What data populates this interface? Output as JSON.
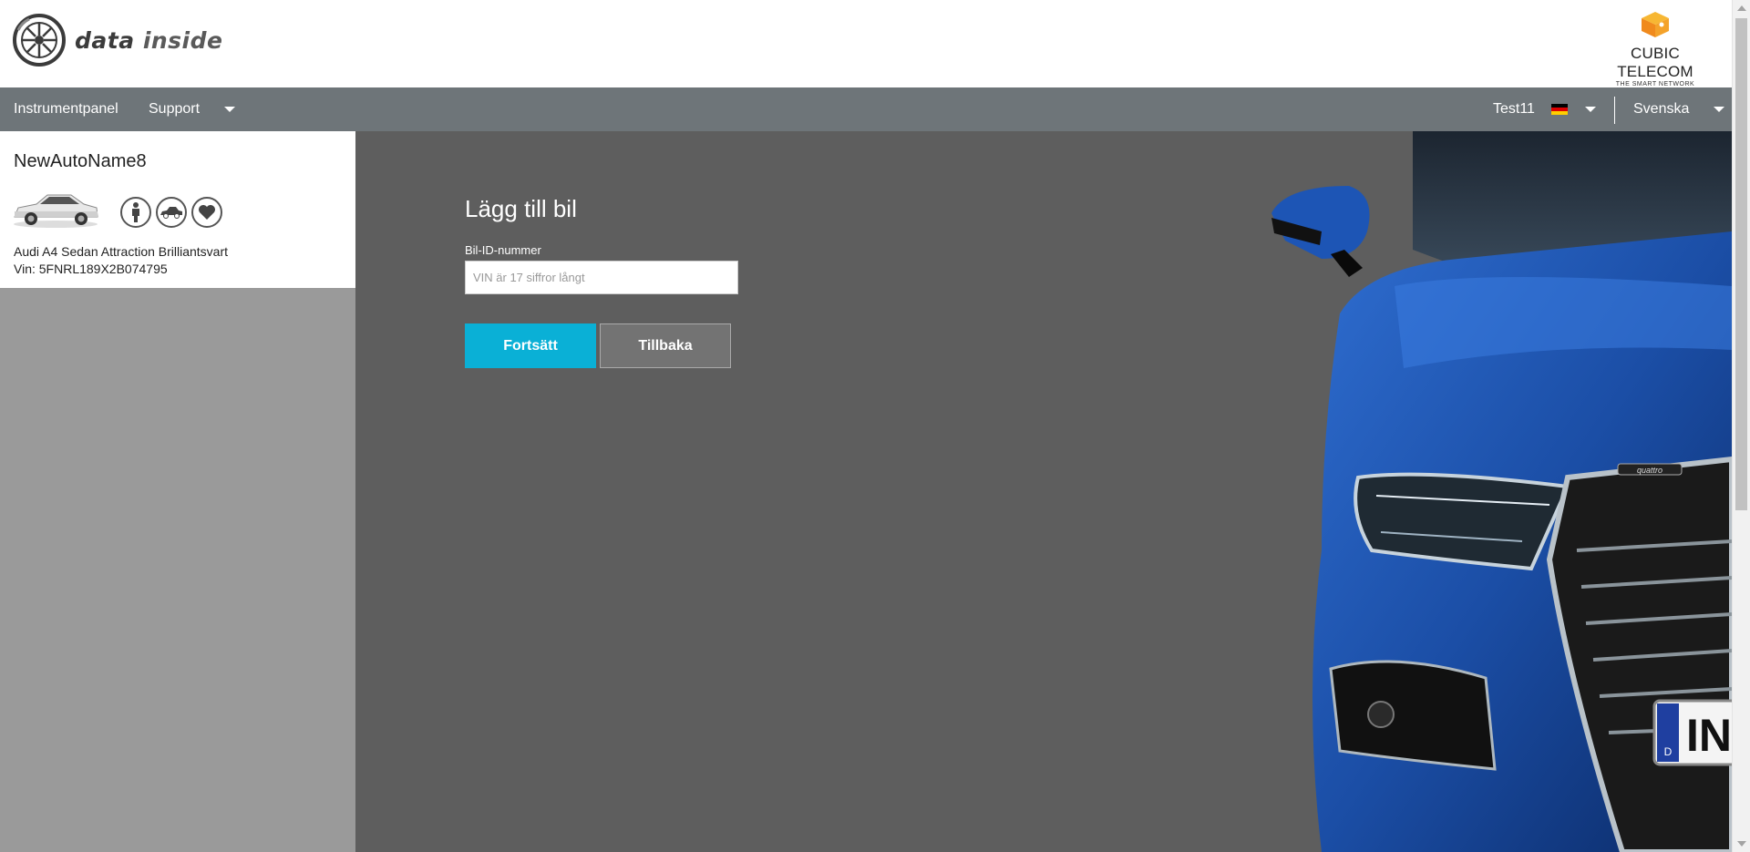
{
  "header": {
    "logo_text_1": "data",
    "logo_text_2": "inside",
    "partner_name": "CUBIC TELECOM",
    "partner_tagline": "THE SMART NETWORK"
  },
  "nav": {
    "dashboard": "Instrumentpanel",
    "support": "Support",
    "user": "Test11",
    "language": "Svenska"
  },
  "vehicle": {
    "name": "NewAutoName8",
    "model": "Audi A4 Sedan Attraction Brilliantsvart",
    "vin": "Vin: 5FNRL189X2B074795",
    "icons": [
      "person-icon",
      "car-icon",
      "heart-icon"
    ]
  },
  "form": {
    "title": "Lägg till bil",
    "vin_label": "Bil-ID-nummer",
    "vin_placeholder": "VIN är 17 siffror långt",
    "vin_value": "",
    "continue_label": "Fortsätt",
    "back_label": "Tillbaka"
  },
  "hero": {
    "plate_country": "D",
    "plate_text": "IN",
    "badge_text": "quattro"
  },
  "colors": {
    "nav_bg": "#6e7579",
    "primary_button": "#0ab0d6",
    "secondary_button": "#737373",
    "main_bg": "#5e5e5e",
    "sidebar_bg": "#9a9a9a",
    "car_blue": "#1b4ea6"
  }
}
